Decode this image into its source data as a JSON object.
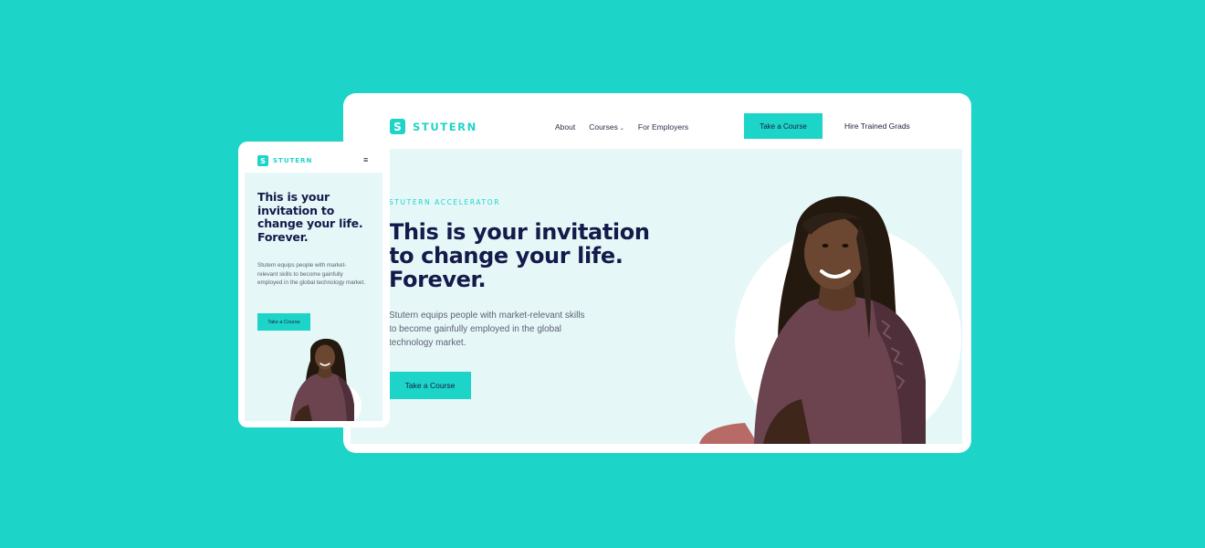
{
  "brand": {
    "name": "STUTERN",
    "mark": "S"
  },
  "desktop": {
    "nav": {
      "about": "About",
      "courses": "Courses",
      "employers": "For Employers",
      "take_course": "Take a Course",
      "hire": "Hire Trained Grads"
    },
    "hero": {
      "eyebrow": "STUTERN  ACCELERATOR",
      "headline": "This is your invitation to change your life. Forever.",
      "description": "Stutern equips people with market-relevant skills to become gainfully employed in the global technology market.",
      "cta": "Take a Course"
    }
  },
  "mobile": {
    "menu_icon": "≡",
    "hero": {
      "headline": "This is your invitation to change your life. Forever.",
      "description": "Stutern equips people with market-relevant skills to become gainfully employed in the global technology market.",
      "cta": "Take a Course"
    }
  },
  "colors": {
    "background": "#1dd4c8",
    "accent": "#1dd4c8",
    "hero_bg": "#e6f7f8",
    "heading": "#141a4a",
    "body_text": "#5c6272"
  }
}
